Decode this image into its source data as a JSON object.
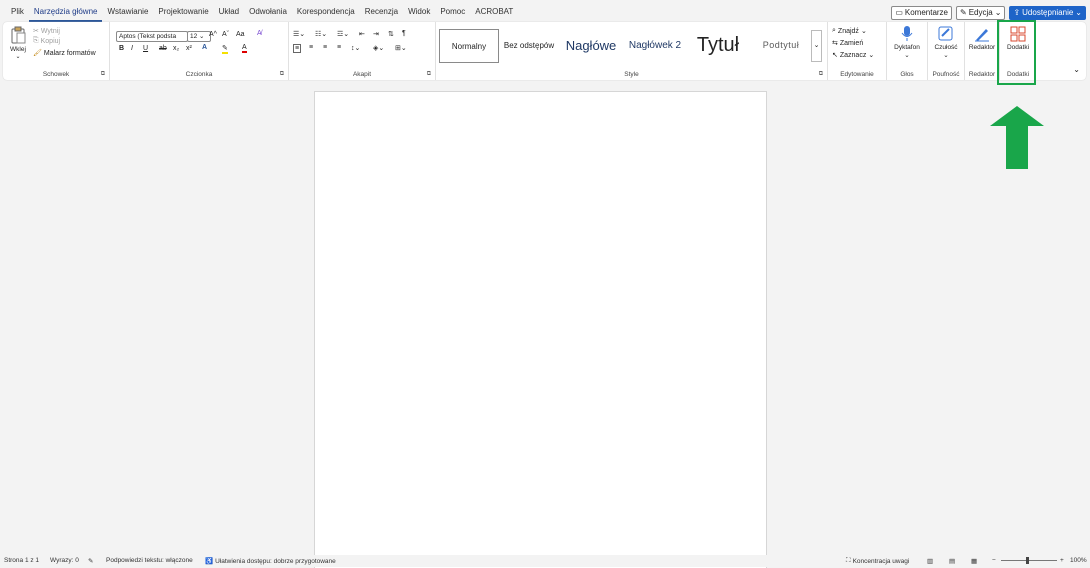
{
  "menu": {
    "tabs": [
      "Plik",
      "Narzędzia główne",
      "Wstawianie",
      "Projektowanie",
      "Układ",
      "Odwołania",
      "Korespondencja",
      "Recenzja",
      "Widok",
      "Pomoc",
      "ACROBAT"
    ],
    "active_tab": "Narzędzia główne"
  },
  "topright": {
    "comments": "Komentarze",
    "editing": "Edycja",
    "share": "Udostępnianie"
  },
  "clipboard": {
    "paste": "Wklej",
    "cut": "Wytnij",
    "copy": "Kopiuj",
    "format_painter": "Malarz formatów",
    "label": "Schowek"
  },
  "font": {
    "font_name": "Aptos (Tekst podsta",
    "font_size": "12",
    "bold": "B",
    "italic": "I",
    "underline": "U",
    "strike": "ab",
    "subscript": "x₂",
    "superscript": "x²",
    "grow": "A^",
    "shrink": "Aˇ",
    "case": "Aa",
    "label": "Czcionka"
  },
  "paragraph": {
    "label": "Akapit",
    "pilcrow": "¶"
  },
  "styles": {
    "items": [
      "Normalny",
      "Bez odstępów",
      "Nagłówe",
      "Nagłówek 2",
      "Tytuł",
      "Podtytuł"
    ],
    "label": "Style"
  },
  "editing": {
    "find": "Znajdź",
    "replace": "Zamień",
    "select": "Zaznacz",
    "label": "Edytowanie"
  },
  "voice": {
    "dictate": "Dyktafon",
    "label": "Głos"
  },
  "sensitivity": {
    "btn": "Czułość",
    "label": "Poufność"
  },
  "editor": {
    "btn": "Redaktor",
    "label": "Redaktor"
  },
  "addins": {
    "btn": "Dodatki",
    "label": "Dodatki"
  },
  "status": {
    "page": "Strona 1 z 1",
    "words": "Wyrazy: 0",
    "predictions": "Podpowiedzi tekstu: włączone",
    "accessibility": "Ułatwienia dostępu: dobrze przygotowane",
    "focus": "Koncentracja uwagi",
    "zoom": "100%"
  },
  "colors": {
    "accent": "#2b579a",
    "share_bg": "#1e64c8",
    "annotation_green": "#19a64a"
  }
}
